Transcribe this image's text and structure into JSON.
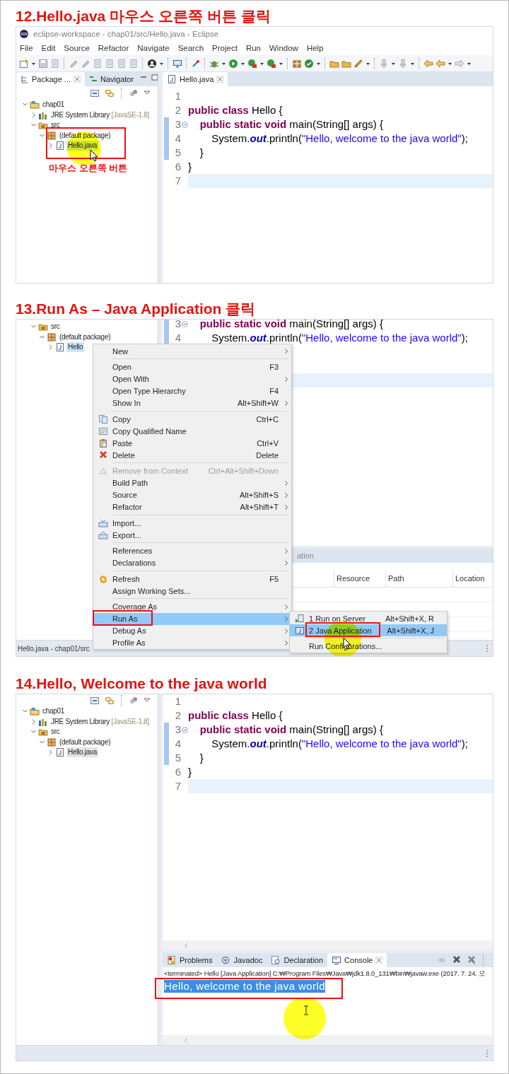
{
  "step_12": {
    "heading": "12.Hello.java 마우스 오른쪽 버튼 클릭",
    "window": {
      "title": "eclipse-workspace - chap01/src/Hello.java - Eclipse",
      "menu": [
        "File",
        "Edit",
        "Source",
        "Refactor",
        "Navigate",
        "Search",
        "Project",
        "Run",
        "Window",
        "Help"
      ]
    },
    "explorer": {
      "tabs": [
        {
          "label": "Package ...",
          "selected": true
        },
        {
          "label": "Navigator",
          "selected": false
        }
      ],
      "tree": [
        {
          "kind": "project",
          "label": "chap01",
          "expanded": true,
          "selected": false,
          "children": [
            {
              "kind": "library",
              "label": "JRE System Library",
              "note": "[JavaSE-1.8]",
              "expanded": false,
              "selected": false
            },
            {
              "kind": "folder",
              "label": "src",
              "expanded": true,
              "selected": false,
              "children": [
                {
                  "kind": "package",
                  "label": "(default package)",
                  "expanded": true,
                  "selected": false,
                  "children": [
                    {
                      "kind": "file",
                      "label": "Hello.java",
                      "expanded": false,
                      "selected": true
                    }
                  ]
                }
              ]
            }
          ]
        }
      ]
    },
    "editor": {
      "tabs": [
        {
          "label": "Hello.java",
          "selected": true
        }
      ],
      "lines": [
        {
          "number": "1",
          "range": false,
          "foldable": false,
          "current": false
        },
        {
          "number": "2",
          "range": false,
          "foldable": false,
          "current": false,
          "tokens": [
            {
              "kind": "keyword",
              "text": "public class"
            },
            {
              "kind": "plain",
              "text": " Hello {"
            }
          ]
        },
        {
          "number": "3",
          "range": true,
          "foldable": true,
          "current": false,
          "tokens": [
            {
              "kind": "keyword",
              "text": "    public static void"
            },
            {
              "kind": "plain",
              "text": " main(String[] args) {"
            }
          ]
        },
        {
          "number": "4",
          "range": true,
          "foldable": false,
          "current": false,
          "tokens": [
            {
              "kind": "plain",
              "text": "        System."
            },
            {
              "kind": "field",
              "text": "out"
            },
            {
              "kind": "plain",
              "text": ".println("
            },
            {
              "kind": "string",
              "text": "\"Hello, welcome to the java world\""
            },
            {
              "kind": "plain",
              "text": ");"
            }
          ]
        },
        {
          "number": "5",
          "range": true,
          "foldable": false,
          "current": false,
          "tokens": [
            {
              "kind": "plain",
              "text": "    }"
            }
          ]
        },
        {
          "number": "6",
          "range": false,
          "foldable": false,
          "current": false,
          "tokens": [
            {
              "kind": "plain",
              "text": "}"
            }
          ]
        },
        {
          "number": "7",
          "range": false,
          "foldable": false,
          "current": true
        }
      ]
    },
    "annotation": "마우스 오른쪽 버튼"
  },
  "step_13": {
    "heading": "13.Run As – Java Application 클릭",
    "explorer": {
      "tree": [
        {
          "kind": "folder",
          "label": "src",
          "expanded": true,
          "selected": false,
          "children": [
            {
              "kind": "package",
              "label": "(default package)",
              "expanded": true,
              "selected": false,
              "children": [
                {
                  "kind": "file",
                  "label": "Hello",
                  "expanded": false,
                  "selected": true
                }
              ]
            }
          ]
        }
      ]
    },
    "editor": {
      "lines": [
        {
          "number": "3",
          "range": true,
          "foldable": true,
          "current": false,
          "tokens": [
            {
              "kind": "keyword",
              "text": "    public static void"
            },
            {
              "kind": "plain",
              "text": " main(String[] args) {"
            }
          ]
        },
        {
          "number": "4",
          "range": true,
          "foldable": false,
          "current": false,
          "tokens": [
            {
              "kind": "plain",
              "text": "        System."
            },
            {
              "kind": "field",
              "text": "out"
            },
            {
              "kind": "plain",
              "text": ".println("
            },
            {
              "kind": "string",
              "text": "\"Hello, welcome to the java world\""
            },
            {
              "kind": "plain",
              "text": ");"
            }
          ]
        },
        {
          "range": false,
          "foldable": false,
          "current": false
        },
        {
          "range": false,
          "foldable": false,
          "current": false
        },
        {
          "range": false,
          "foldable": false,
          "current": true
        }
      ]
    },
    "bottom_panel": {
      "tabs": [
        {
          "label": "ation",
          "selected": false
        }
      ],
      "columns": [
        "Resource",
        "Path",
        "Location"
      ]
    },
    "status_bar": "Hello.java - chap01/src",
    "context_menu": {
      "items": [
        {
          "kind": "plain",
          "label": "New",
          "submenu": true,
          "disabled": false,
          "selected": false
        },
        {
          "kind": "separator"
        },
        {
          "kind": "plain",
          "label": "Open",
          "shortcut": "F3",
          "submenu": false,
          "disabled": false,
          "selected": false
        },
        {
          "kind": "plain",
          "label": "Open With",
          "submenu": true,
          "disabled": false,
          "selected": false
        },
        {
          "kind": "plain",
          "label": "Open Type Hierarchy",
          "shortcut": "F4",
          "submenu": false,
          "disabled": false,
          "selected": false
        },
        {
          "kind": "plain",
          "label": "Show In",
          "shortcut": "Alt+Shift+W",
          "submenu": true,
          "disabled": false,
          "selected": false
        },
        {
          "kind": "separator"
        },
        {
          "kind": "copy",
          "label": "Copy",
          "shortcut": "Ctrl+C",
          "submenu": false,
          "disabled": false,
          "selected": false
        },
        {
          "kind": "copy-name",
          "label": "Copy Qualified Name",
          "submenu": false,
          "disabled": false,
          "selected": false
        },
        {
          "kind": "paste",
          "label": "Paste",
          "shortcut": "Ctrl+V",
          "submenu": false,
          "disabled": false,
          "selected": false
        },
        {
          "kind": "delete",
          "label": "Delete",
          "shortcut": "Delete",
          "submenu": false,
          "disabled": false,
          "selected": false
        },
        {
          "kind": "separator"
        },
        {
          "kind": "remove",
          "label": "Remove from Context",
          "shortcut": "Ctrl+Alt+Shift+Down",
          "submenu": false,
          "disabled": true,
          "selected": false
        },
        {
          "kind": "plain",
          "label": "Build Path",
          "submenu": true,
          "disabled": false,
          "selected": false
        },
        {
          "kind": "plain",
          "label": "Source",
          "shortcut": "Alt+Shift+S",
          "submenu": true,
          "disabled": false,
          "selected": false
        },
        {
          "kind": "plain",
          "label": "Refactor",
          "shortcut": "Alt+Shift+T",
          "submenu": true,
          "disabled": false,
          "selected": false
        },
        {
          "kind": "separator"
        },
        {
          "kind": "import",
          "label": "Import...",
          "submenu": false,
          "disabled": false,
          "selected": false
        },
        {
          "kind": "export",
          "label": "Export...",
          "submenu": false,
          "disabled": false,
          "selected": false
        },
        {
          "kind": "separator"
        },
        {
          "kind": "plain",
          "label": "References",
          "submenu": true,
          "disabled": false,
          "selected": false
        },
        {
          "kind": "plain",
          "label": "Declarations",
          "submenu": true,
          "disabled": false,
          "selected": false
        },
        {
          "kind": "separator"
        },
        {
          "kind": "refresh",
          "label": "Refresh",
          "shortcut": "F5",
          "submenu": false,
          "disabled": false,
          "selected": false
        },
        {
          "kind": "plain",
          "label": "Assign Working Sets...",
          "submenu": false,
          "disabled": false,
          "selected": false
        },
        {
          "kind": "separator"
        },
        {
          "kind": "plain",
          "label": "Coverage As",
          "submenu": true,
          "disabled": false,
          "selected": false
        },
        {
          "kind": "plain",
          "label": "Run As",
          "submenu": true,
          "disabled": false,
          "selected": true
        },
        {
          "kind": "plain",
          "label": "Debug As",
          "submenu": true,
          "disabled": false,
          "selected": false
        },
        {
          "kind": "plain",
          "label": "Profile As",
          "submenu": true,
          "disabled": false,
          "selected": false
        }
      ]
    },
    "submenu": {
      "items": [
        {
          "kind": "server",
          "label": "1 Run on Server",
          "shortcut": "Alt+Shift+X, R",
          "submenu": false,
          "disabled": false,
          "selected": false
        },
        {
          "kind": "java-app",
          "label": "2 Java Application",
          "shortcut": "Alt+Shift+X, J",
          "submenu": false,
          "disabled": false,
          "selected": true
        },
        {
          "kind": "separator"
        },
        {
          "kind": "plain",
          "label": "Run Configurations...",
          "submenu": false,
          "disabled": false,
          "selected": false
        }
      ]
    }
  },
  "step_14": {
    "heading": "14.Hello, Welcome to the java world",
    "explorer": {
      "tree": [
        {
          "kind": "project",
          "label": "chap01",
          "expanded": true,
          "selected": false,
          "children": [
            {
              "kind": "library",
              "label": "JRE System Library",
              "note": "[JavaSE-1.8]",
              "expanded": false,
              "selected": false
            },
            {
              "kind": "folder",
              "label": "src",
              "expanded": true,
              "selected": false,
              "children": [
                {
                  "kind": "package",
                  "label": "(default package)",
                  "expanded": true,
                  "selected": false,
                  "children": [
                    {
                      "kind": "file",
                      "label": "Hello.java",
                      "expanded": false,
                      "selected": true
                    }
                  ]
                }
              ]
            }
          ]
        }
      ]
    },
    "editor": {
      "lines": [
        {
          "number": "1",
          "range": false,
          "foldable": false,
          "current": false
        },
        {
          "number": "2",
          "range": false,
          "foldable": false,
          "current": false,
          "tokens": [
            {
              "kind": "keyword",
              "text": "public class"
            },
            {
              "kind": "plain",
              "text": " Hello {"
            }
          ]
        },
        {
          "number": "3",
          "range": true,
          "foldable": true,
          "current": false,
          "tokens": [
            {
              "kind": "keyword",
              "text": "    public static void"
            },
            {
              "kind": "plain",
              "text": " main(String[] args) {"
            }
          ]
        },
        {
          "number": "4",
          "range": true,
          "foldable": false,
          "current": false,
          "tokens": [
            {
              "kind": "plain",
              "text": "        System."
            },
            {
              "kind": "field",
              "text": "out"
            },
            {
              "kind": "plain",
              "text": ".println("
            },
            {
              "kind": "string",
              "text": "\"Hello, welcome to the java world\""
            },
            {
              "kind": "plain",
              "text": ");"
            }
          ]
        },
        {
          "number": "5",
          "range": true,
          "foldable": false,
          "current": false,
          "tokens": [
            {
              "kind": "plain",
              "text": "    }"
            }
          ]
        },
        {
          "number": "6",
          "range": false,
          "foldable": false,
          "current": false,
          "tokens": [
            {
              "kind": "plain",
              "text": "}"
            }
          ]
        },
        {
          "number": "7",
          "range": false,
          "foldable": false,
          "current": true
        }
      ]
    },
    "console": {
      "tabs": [
        {
          "kind": "problems",
          "label": "Problems",
          "selected": false
        },
        {
          "kind": "javadoc",
          "label": "Javadoc",
          "selected": false
        },
        {
          "kind": "declaration",
          "label": "Declaration",
          "selected": false
        },
        {
          "kind": "console",
          "label": "Console",
          "selected": true
        }
      ],
      "header": "<terminated> Hello [Java Application] C:₩Program Files₩Java₩jdk1.8.0_131₩bin₩javaw.exe (2017. 7. 24. 오",
      "output": {
        "text": "Hello, welcome to the java world",
        "selected": true
      }
    }
  }
}
